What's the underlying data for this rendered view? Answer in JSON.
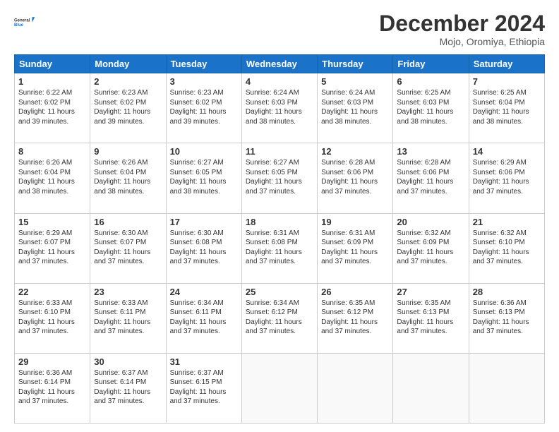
{
  "logo": {
    "line1": "General",
    "line2": "Blue"
  },
  "title": "December 2024",
  "subtitle": "Mojo, Oromiya, Ethiopia",
  "days_of_week": [
    "Sunday",
    "Monday",
    "Tuesday",
    "Wednesday",
    "Thursday",
    "Friday",
    "Saturday"
  ],
  "weeks": [
    [
      {
        "day": 1,
        "sunrise": "6:22 AM",
        "sunset": "6:02 PM",
        "daylight": "11 hours and 39 minutes."
      },
      {
        "day": 2,
        "sunrise": "6:23 AM",
        "sunset": "6:02 PM",
        "daylight": "11 hours and 39 minutes."
      },
      {
        "day": 3,
        "sunrise": "6:23 AM",
        "sunset": "6:02 PM",
        "daylight": "11 hours and 39 minutes."
      },
      {
        "day": 4,
        "sunrise": "6:24 AM",
        "sunset": "6:03 PM",
        "daylight": "11 hours and 38 minutes."
      },
      {
        "day": 5,
        "sunrise": "6:24 AM",
        "sunset": "6:03 PM",
        "daylight": "11 hours and 38 minutes."
      },
      {
        "day": 6,
        "sunrise": "6:25 AM",
        "sunset": "6:03 PM",
        "daylight": "11 hours and 38 minutes."
      },
      {
        "day": 7,
        "sunrise": "6:25 AM",
        "sunset": "6:04 PM",
        "daylight": "11 hours and 38 minutes."
      }
    ],
    [
      {
        "day": 8,
        "sunrise": "6:26 AM",
        "sunset": "6:04 PM",
        "daylight": "11 hours and 38 minutes."
      },
      {
        "day": 9,
        "sunrise": "6:26 AM",
        "sunset": "6:04 PM",
        "daylight": "11 hours and 38 minutes."
      },
      {
        "day": 10,
        "sunrise": "6:27 AM",
        "sunset": "6:05 PM",
        "daylight": "11 hours and 38 minutes."
      },
      {
        "day": 11,
        "sunrise": "6:27 AM",
        "sunset": "6:05 PM",
        "daylight": "11 hours and 37 minutes."
      },
      {
        "day": 12,
        "sunrise": "6:28 AM",
        "sunset": "6:06 PM",
        "daylight": "11 hours and 37 minutes."
      },
      {
        "day": 13,
        "sunrise": "6:28 AM",
        "sunset": "6:06 PM",
        "daylight": "11 hours and 37 minutes."
      },
      {
        "day": 14,
        "sunrise": "6:29 AM",
        "sunset": "6:06 PM",
        "daylight": "11 hours and 37 minutes."
      }
    ],
    [
      {
        "day": 15,
        "sunrise": "6:29 AM",
        "sunset": "6:07 PM",
        "daylight": "11 hours and 37 minutes."
      },
      {
        "day": 16,
        "sunrise": "6:30 AM",
        "sunset": "6:07 PM",
        "daylight": "11 hours and 37 minutes."
      },
      {
        "day": 17,
        "sunrise": "6:30 AM",
        "sunset": "6:08 PM",
        "daylight": "11 hours and 37 minutes."
      },
      {
        "day": 18,
        "sunrise": "6:31 AM",
        "sunset": "6:08 PM",
        "daylight": "11 hours and 37 minutes."
      },
      {
        "day": 19,
        "sunrise": "6:31 AM",
        "sunset": "6:09 PM",
        "daylight": "11 hours and 37 minutes."
      },
      {
        "day": 20,
        "sunrise": "6:32 AM",
        "sunset": "6:09 PM",
        "daylight": "11 hours and 37 minutes."
      },
      {
        "day": 21,
        "sunrise": "6:32 AM",
        "sunset": "6:10 PM",
        "daylight": "11 hours and 37 minutes."
      }
    ],
    [
      {
        "day": 22,
        "sunrise": "6:33 AM",
        "sunset": "6:10 PM",
        "daylight": "11 hours and 37 minutes."
      },
      {
        "day": 23,
        "sunrise": "6:33 AM",
        "sunset": "6:11 PM",
        "daylight": "11 hours and 37 minutes."
      },
      {
        "day": 24,
        "sunrise": "6:34 AM",
        "sunset": "6:11 PM",
        "daylight": "11 hours and 37 minutes."
      },
      {
        "day": 25,
        "sunrise": "6:34 AM",
        "sunset": "6:12 PM",
        "daylight": "11 hours and 37 minutes."
      },
      {
        "day": 26,
        "sunrise": "6:35 AM",
        "sunset": "6:12 PM",
        "daylight": "11 hours and 37 minutes."
      },
      {
        "day": 27,
        "sunrise": "6:35 AM",
        "sunset": "6:13 PM",
        "daylight": "11 hours and 37 minutes."
      },
      {
        "day": 28,
        "sunrise": "6:36 AM",
        "sunset": "6:13 PM",
        "daylight": "11 hours and 37 minutes."
      }
    ],
    [
      {
        "day": 29,
        "sunrise": "6:36 AM",
        "sunset": "6:14 PM",
        "daylight": "11 hours and 37 minutes."
      },
      {
        "day": 30,
        "sunrise": "6:37 AM",
        "sunset": "6:14 PM",
        "daylight": "11 hours and 37 minutes."
      },
      {
        "day": 31,
        "sunrise": "6:37 AM",
        "sunset": "6:15 PM",
        "daylight": "11 hours and 37 minutes."
      },
      null,
      null,
      null,
      null
    ]
  ]
}
